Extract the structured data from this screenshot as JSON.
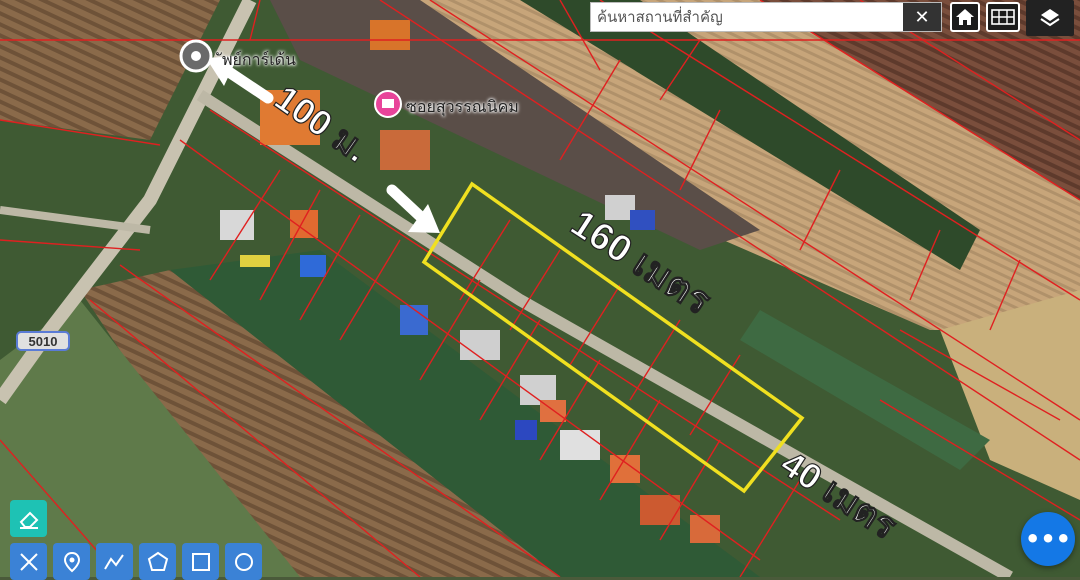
{
  "search": {
    "placeholder": "ค้นหาสถานที่สำคัญ",
    "clear_label": "✕"
  },
  "toolbar": {
    "home_icon": "home-icon",
    "grid_icon": "grid-icon",
    "layers_icon": "layers-icon"
  },
  "poi": {
    "garden_label": "ัพย์การ์เด้น",
    "soi_label": "ซอยสุวรรณนิคม"
  },
  "road_badge": "5010",
  "annotations": {
    "distance_label": "100 ม.",
    "length_label": "160 เมตร",
    "width_label": "40 เมตร"
  },
  "drawing_tools": [
    "eraser-icon",
    "measure-icon",
    "pin-icon",
    "polyline-icon",
    "polygon-icon",
    "rectangle-icon",
    "circle-icon"
  ],
  "fab_label": "•••",
  "colors": {
    "parcel_line": "#e02020",
    "highlight": "#f0e020",
    "tool_blue": "#3b82d6",
    "tool_teal": "#1ec2b4",
    "fab": "#1478e6"
  }
}
